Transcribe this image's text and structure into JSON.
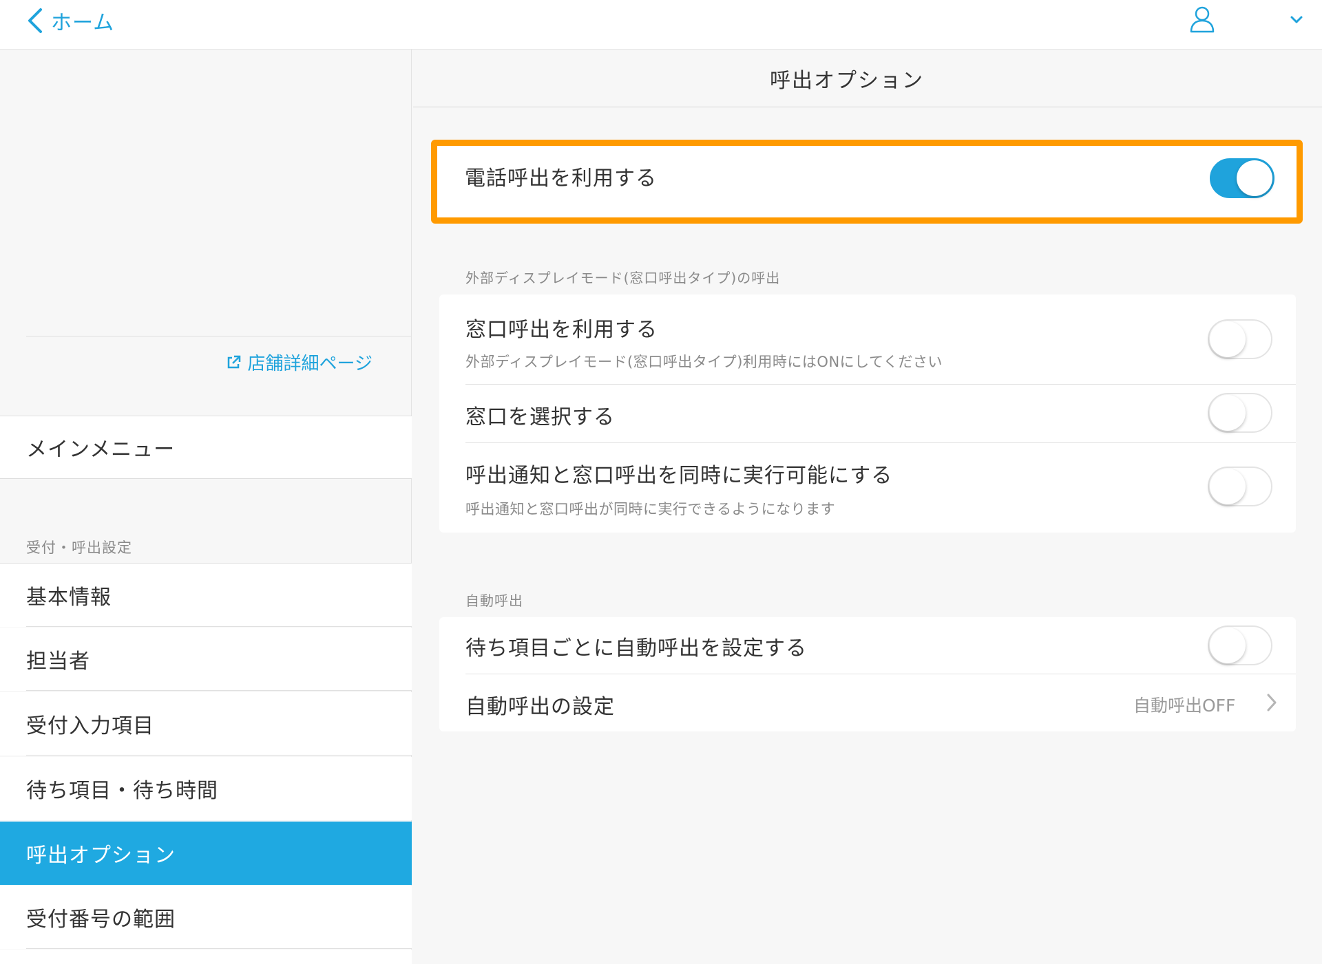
{
  "topbar": {
    "back_label": "ホーム"
  },
  "sidebar": {
    "store_link_label": "店舗詳細ページ",
    "main_menu_label": "メインメニュー",
    "section_label": "受付・呼出設定",
    "items": [
      {
        "label": "基本情報"
      },
      {
        "label": "担当者"
      },
      {
        "label": "受付入力項目"
      },
      {
        "label": "待ち項目・待ち時間"
      },
      {
        "label": "呼出オプション"
      },
      {
        "label": "受付番号の範囲"
      }
    ],
    "active_index": 4
  },
  "main": {
    "title": "呼出オプション",
    "phone_call": {
      "label": "電話呼出を利用する",
      "enabled": true
    },
    "external_display": {
      "group_label": "外部ディスプレイモード(窓口呼出タイプ)の呼出",
      "rows": [
        {
          "title": "窓口呼出を利用する",
          "subtitle": "外部ディスプレイモード(窓口呼出タイプ)利用時にはONにしてください",
          "enabled": false
        },
        {
          "title": "窓口を選択する",
          "enabled": false
        },
        {
          "title": "呼出通知と窓口呼出を同時に実行可能にする",
          "subtitle": "呼出通知と窓口呼出が同時に実行できるようになります",
          "enabled": false
        }
      ]
    },
    "auto_call": {
      "group_label": "自動呼出",
      "per_item": {
        "title": "待ち項目ごとに自動呼出を設定する",
        "enabled": false
      },
      "settings": {
        "title": "自動呼出の設定",
        "value": "自動呼出OFF"
      }
    }
  },
  "colors": {
    "accent": "#1fa3dc",
    "active_bg": "#1fa9e1",
    "highlight": "#ff9a00"
  },
  "icons": {
    "back": "chevron-left-icon",
    "user": "user-icon",
    "caret": "chevron-down-icon",
    "external": "external-link-icon",
    "chevron_right": "chevron-right-icon"
  }
}
